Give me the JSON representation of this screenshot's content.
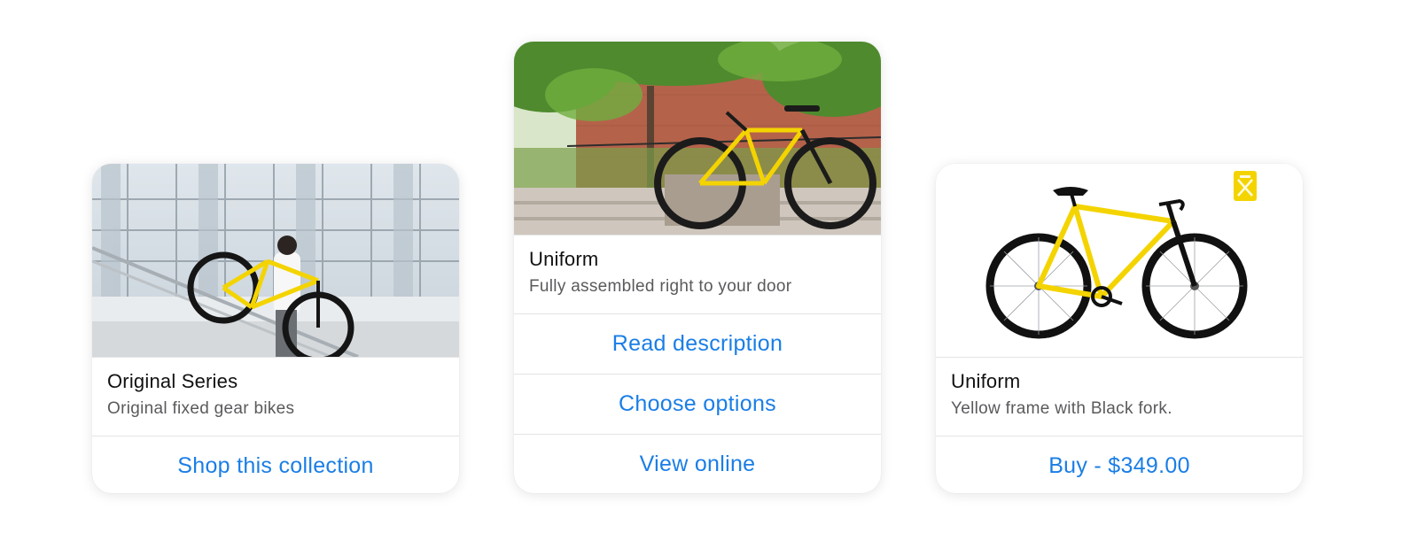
{
  "cards": [
    {
      "title": "Original Series",
      "subtitle": "Original fixed gear bikes",
      "actions": [
        "Shop this collection"
      ]
    },
    {
      "title": "Uniform",
      "subtitle": "Fully assembled right to your door",
      "actions": [
        "Read description",
        "Choose options",
        "View online"
      ]
    },
    {
      "title": "Uniform",
      "subtitle": "Yellow frame with Black fork.",
      "actions": [
        "Buy - $349.00"
      ]
    }
  ],
  "colors": {
    "link": "#1a7ee6",
    "frame_yellow": "#f4d400",
    "divider": "#e4e4e6"
  }
}
